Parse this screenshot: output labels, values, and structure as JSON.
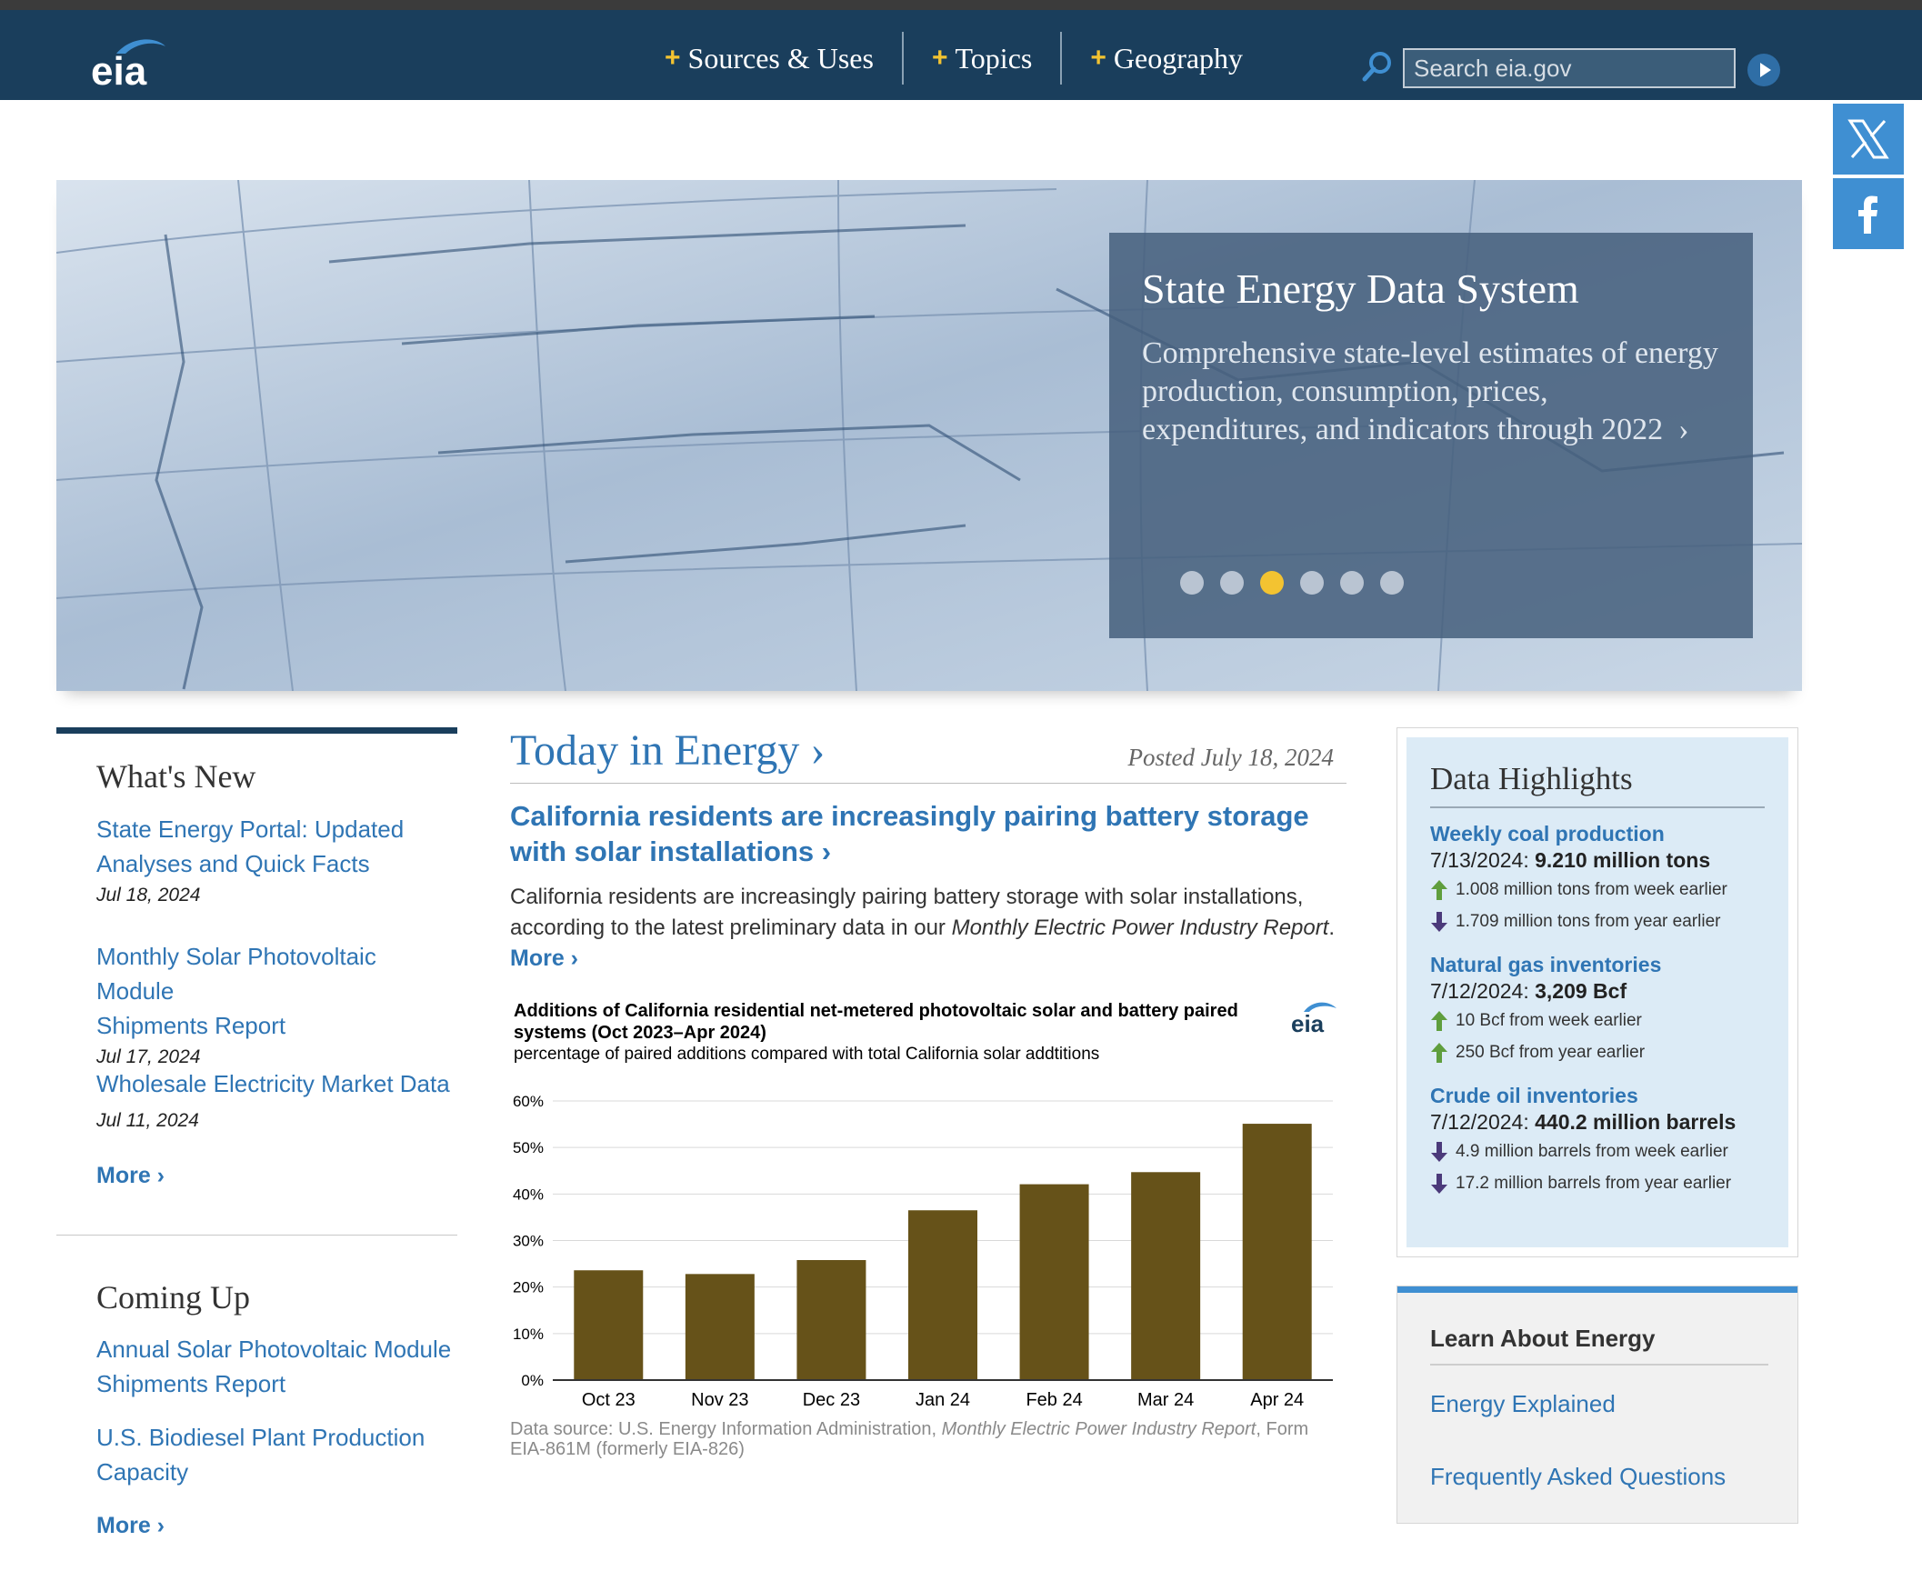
{
  "header": {
    "nav": [
      {
        "label": "Sources & Uses"
      },
      {
        "label": "Topics"
      },
      {
        "label": "Geography"
      }
    ],
    "search_placeholder": "Search eia.gov",
    "logo_text": "eia"
  },
  "hero": {
    "title": "State Energy Data System",
    "description": "Comprehensive state-level estimates of energy production, consumption, prices, expenditures, and indicators through 2022",
    "arrow": "›",
    "slide_count": 6,
    "active_slide": 3
  },
  "whats_new": {
    "title": "What's New",
    "items": [
      {
        "label_line1": "State Energy Portal: Updated",
        "label_line2": "Analyses and Quick Facts",
        "date": "Jul 18, 2024"
      },
      {
        "label_line1": "Monthly Solar Photovoltaic Module",
        "label_line2": "Shipments Report",
        "date": "Jul 17, 2024"
      },
      {
        "label_line1": "Wholesale Electricity Market Data",
        "date": "Jul 11, 2024"
      }
    ],
    "more": "More ›"
  },
  "coming_up": {
    "title": "Coming Up",
    "items": [
      {
        "label_line1": "Annual Solar Photovoltaic Module",
        "label_line2": "Shipments Report"
      },
      {
        "label_line1": "U.S. Biodiesel Plant Production",
        "label_line2": "Capacity"
      }
    ],
    "more": "More ›"
  },
  "today": {
    "title": "Today in Energy ›",
    "posted": "Posted July 18, 2024",
    "headline": "California residents are increasingly pairing battery storage with solar installations ›",
    "summary_start": "California residents are increasingly pairing battery storage with solar installations, according to the latest preliminary data in our ",
    "summary_report": "Monthly Electric Power Industry Report",
    "summary_end": ".",
    "more": "More ›",
    "chart_title": "Additions of California residential net-metered photovoltaic solar and battery paired systems (Oct 2023–Apr 2024)",
    "chart_subtitle": "percentage of paired additions compared with total California solar addtitions",
    "source_start": "Data source: U.S. Energy Information Administration, ",
    "source_report": "Monthly Electric Power Industry Report",
    "source_end": ", Form EIA-861M (formerly EIA-826)"
  },
  "chart_data": {
    "type": "bar",
    "title": "Additions of California residential net-metered photovoltaic solar and battery paired systems (Oct 2023–Apr 2024)",
    "subtitle": "percentage of paired additions compared with total California solar addtitions",
    "categories": [
      "Oct 23",
      "Nov 23",
      "Dec 23",
      "Jan 24",
      "Feb 24",
      "Mar 24",
      "Apr 24"
    ],
    "values": [
      23.6,
      22.8,
      25.8,
      36.5,
      42.1,
      44.7,
      55.1
    ],
    "ylim": [
      0,
      60
    ],
    "yticks": [
      "0%",
      "10%",
      "20%",
      "30%",
      "40%",
      "50%",
      "60%"
    ],
    "bar_color": "#665219",
    "grid": true,
    "xlabel": "",
    "ylabel": ""
  },
  "data_highlights": {
    "title": "Data Highlights",
    "items": [
      {
        "name": "Weekly coal production",
        "date": "7/13/2024: ",
        "value": "9.210 million tons",
        "changes": [
          {
            "dir": "up",
            "text": "1.008 million tons from week earlier"
          },
          {
            "dir": "down",
            "text": "1.709 million tons from year earlier"
          }
        ]
      },
      {
        "name": "Natural gas inventories",
        "date": "7/12/2024: ",
        "value": "3,209 Bcf",
        "changes": [
          {
            "dir": "up",
            "text": "10 Bcf from week earlier"
          },
          {
            "dir": "up",
            "text": "250 Bcf from year earlier"
          }
        ]
      },
      {
        "name": "Crude oil inventories",
        "date": "7/12/2024: ",
        "value": "440.2 million barrels",
        "changes": [
          {
            "dir": "down",
            "text": "4.9 million barrels from week earlier"
          },
          {
            "dir": "down",
            "text": "17.2 million barrels from year earlier"
          }
        ]
      }
    ]
  },
  "learn": {
    "title": "Learn About Energy",
    "links": [
      "Energy Explained",
      "Frequently Asked Questions"
    ]
  },
  "colors": {
    "header_bg": "#1a3e5c",
    "link": "#2f75b4",
    "accent_yellow": "#f3c331",
    "arrow_up": "#5f9e3d",
    "arrow_down": "#4b3a7a",
    "social_blue": "#3f8fd2"
  }
}
